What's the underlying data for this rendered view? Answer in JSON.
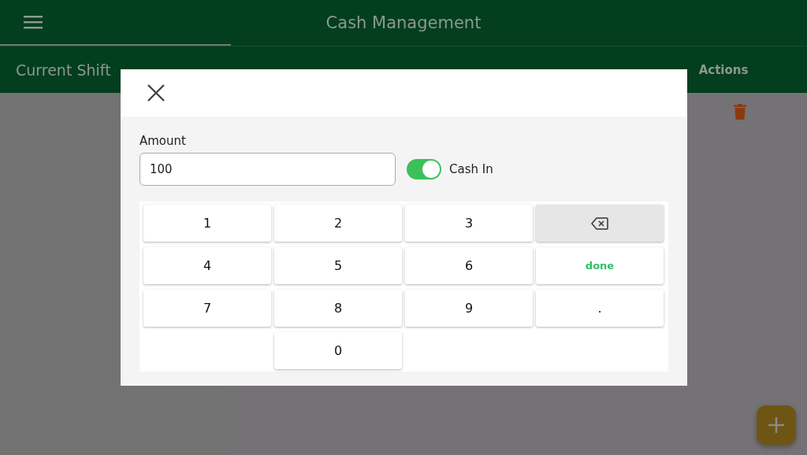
{
  "app_bar": {
    "title": "Cash Management"
  },
  "sidebar": {
    "label": "Current Shift"
  },
  "table": {
    "columns": [
      "Actions"
    ]
  },
  "dialog": {
    "amount_label": "Amount",
    "amount_value": "100",
    "cash_in": {
      "label": "Cash In",
      "on": true
    },
    "keys": [
      {
        "kind": "digit",
        "label": "1"
      },
      {
        "kind": "digit",
        "label": "2"
      },
      {
        "kind": "digit",
        "label": "3"
      },
      {
        "kind": "backspace"
      },
      {
        "kind": "digit",
        "label": "4"
      },
      {
        "kind": "digit",
        "label": "5"
      },
      {
        "kind": "digit",
        "label": "6"
      },
      {
        "kind": "done",
        "label": "done"
      },
      {
        "kind": "digit",
        "label": "7"
      },
      {
        "kind": "digit",
        "label": "8"
      },
      {
        "kind": "digit",
        "label": "9"
      },
      {
        "kind": "digit",
        "label": "."
      },
      {
        "kind": "digit",
        "label": "0"
      }
    ]
  }
}
